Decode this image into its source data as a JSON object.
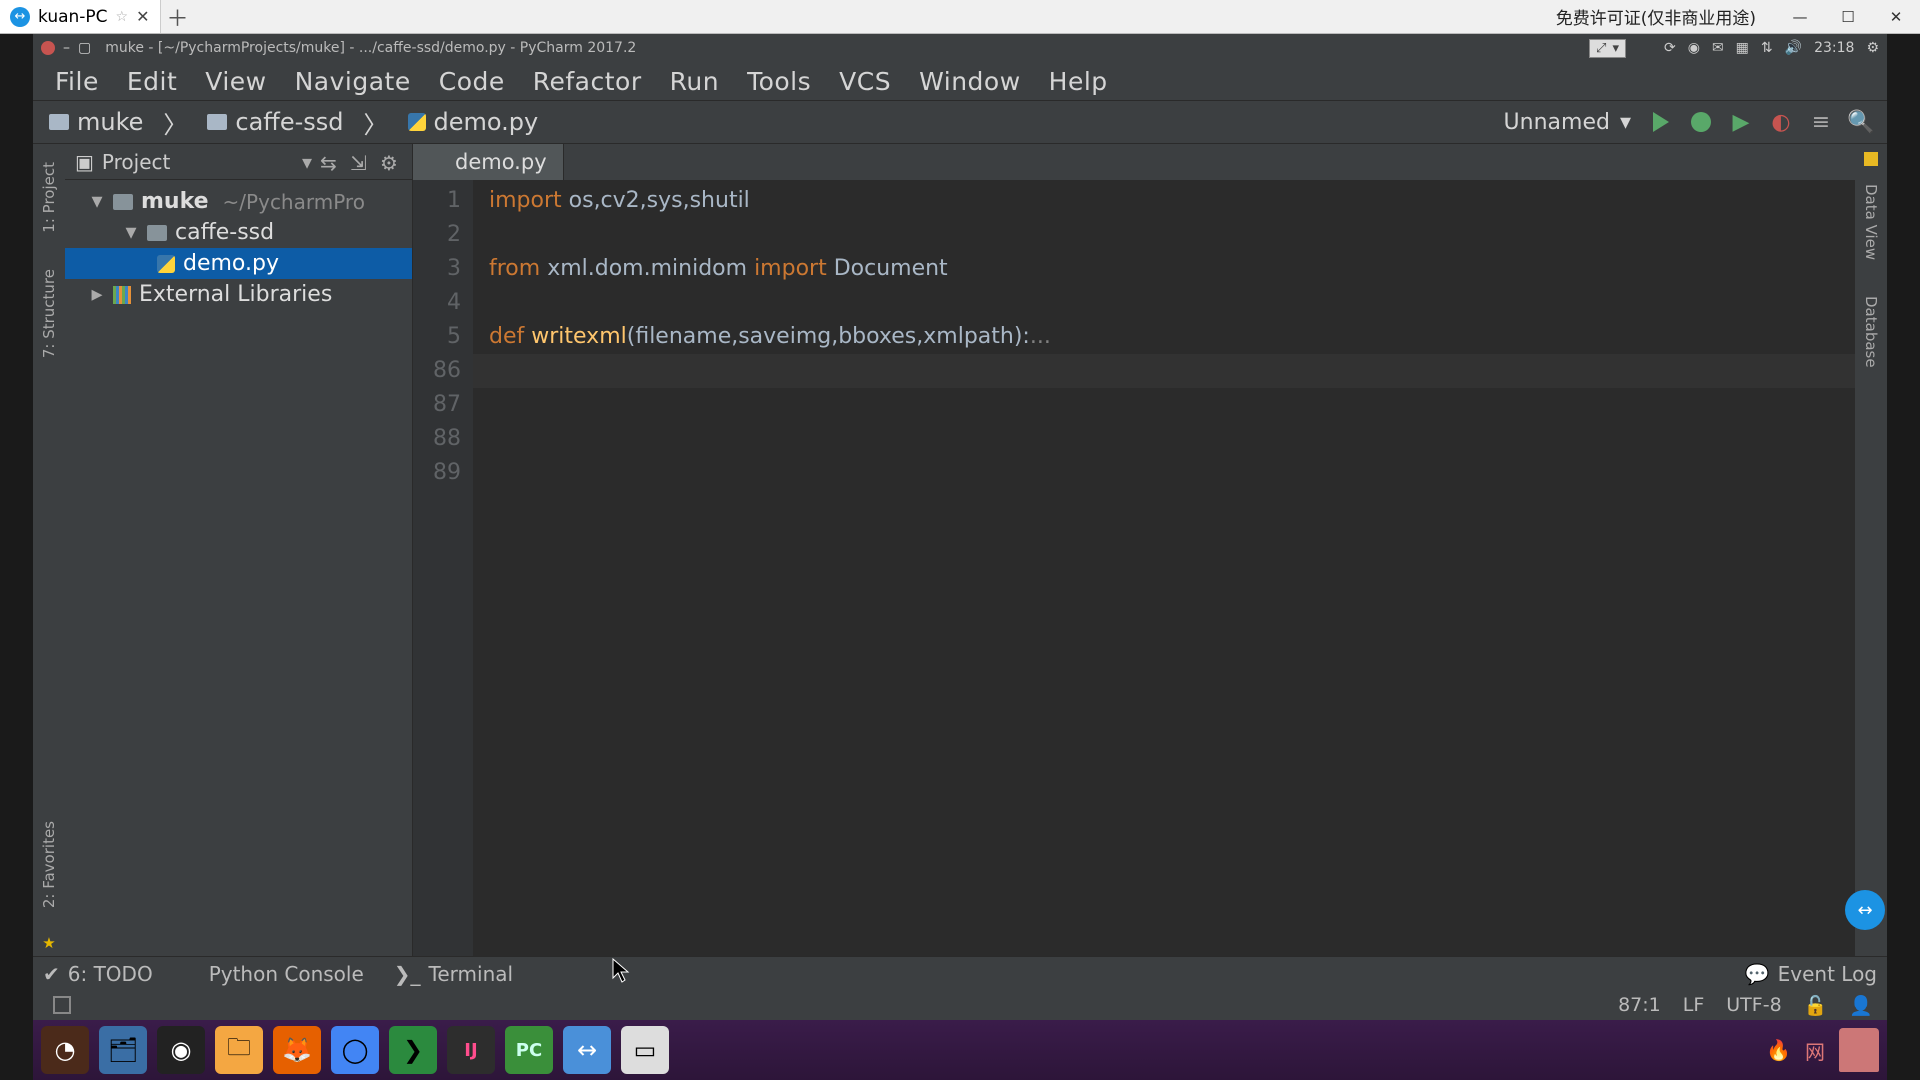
{
  "host_tab": {
    "title": "kuan-PC"
  },
  "license": "免费许可证(仅非商业用途)",
  "remote_title": "muke - [~/PycharmProjects/muke] - .../caffe-ssd/demo.py - PyCharm 2017.2",
  "sys_time": "23:18",
  "menu": {
    "file": "File",
    "edit": "Edit",
    "view": "View",
    "navigate": "Navigate",
    "code": "Code",
    "refactor": "Refactor",
    "run": "Run",
    "tools": "Tools",
    "vcs": "VCS",
    "window": "Window",
    "help": "Help"
  },
  "breadcrumb": {
    "root": "muke",
    "folder": "caffe-ssd",
    "file": "demo.py"
  },
  "run_config": "Unnamed",
  "project_pane": {
    "title": "Project",
    "root": {
      "name": "muke",
      "hint": "~/PycharmPro"
    },
    "folder": {
      "name": "caffe-ssd"
    },
    "file": {
      "name": "demo.py"
    },
    "external": "External Libraries"
  },
  "left_tools": {
    "project": "1: Project",
    "structure": "7: Structure",
    "favorites": "2: Favorites"
  },
  "right_tools": {
    "dataview": "Data View",
    "database": "Database"
  },
  "editor_tab": "demo.py",
  "gutter": [
    "1",
    "2",
    "3",
    "4",
    "5",
    "86",
    "87",
    "88",
    "89"
  ],
  "code": {
    "l1a": "import ",
    "l1b": "os,cv2,sys,shutil",
    "l3a": "from ",
    "l3b": "xml.dom.minidom ",
    "l3c": "import ",
    "l3d": "Document",
    "l5a": "def ",
    "l5b": "writexml",
    "l5c": "(filename,saveimg,bboxes,xmlpath):",
    "l5d": "..."
  },
  "bottom_tools": {
    "todo": "6: TODO",
    "pyconsole": "Python Console",
    "terminal": "Terminal",
    "eventlog": "Event Log"
  },
  "status": {
    "pos": "87:1",
    "sep": "LF",
    "enc": "UTF-8"
  }
}
